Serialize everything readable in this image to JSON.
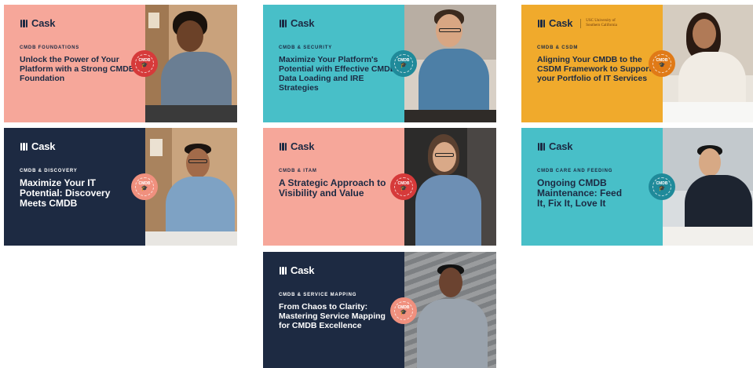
{
  "brand": {
    "logo_text": "Cask"
  },
  "cards": [
    {
      "kicker": "CMDB FOUNDATIONS",
      "headline": "Unlock the Power of Your Platform with a Strong CMDB Foundation",
      "badge": "CMDB",
      "theme": "salmon",
      "badge_color": "#d63a3a"
    },
    {
      "kicker": "CMDB & SECURITY",
      "headline": "Maximize Your Platform's Potential with Effective CMDB Data Loading and IRE Strategies",
      "badge": "CMDB",
      "theme": "teal",
      "badge_color": "#1f8a9a"
    },
    {
      "kicker": "CMDB & CSDM",
      "headline": "Aligning Your CMDB to the CSDM Framework to Support your Portfolio of IT Services",
      "badge": "CMDB",
      "theme": "gold",
      "badge_color": "#e07a17",
      "partner": "USC University of Southern California"
    },
    {
      "kicker": "CMDB & DISCOVERY",
      "headline": "Maximize Your IT Potential: Discovery Meets CMDB",
      "badge": "CMDB",
      "theme": "navy",
      "badge_color": "#f0907e"
    },
    {
      "kicker": "CMDB & ITAM",
      "headline": "A Strategic Approach to Visibility and Value",
      "badge": "CMDB",
      "theme": "salmon",
      "badge_color": "#d63a3a"
    },
    {
      "kicker": "CMDB CARE AND FEEDING",
      "headline": "Ongoing CMDB Maintenance: Feed It, Fix It, Love It",
      "badge": "CMDB",
      "theme": "teal",
      "badge_color": "#1f8a9a"
    },
    {
      "kicker": "CMDB & SERVICE MAPPING",
      "headline": "From Chaos to Clarity: Mastering Service Mapping for CMDB Excellence",
      "badge": "CMDB",
      "theme": "navy",
      "badge_color": "#f0907e"
    }
  ]
}
